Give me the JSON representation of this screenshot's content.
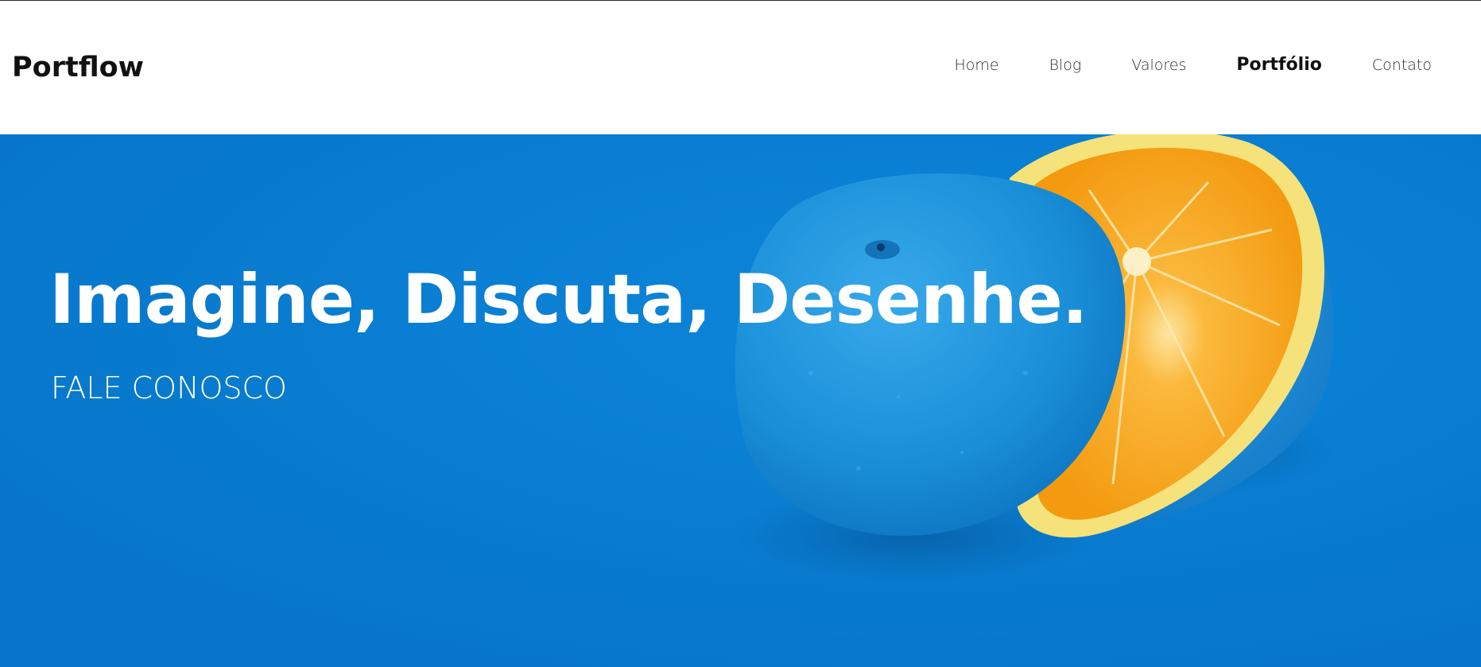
{
  "brand": {
    "name": "Portflow"
  },
  "nav": {
    "items": [
      {
        "label": "Home"
      },
      {
        "label": "Blog"
      },
      {
        "label": "Valores"
      },
      {
        "label": "Portfólio",
        "active": true
      },
      {
        "label": "Contato"
      }
    ]
  },
  "hero": {
    "headline": "Imagine, Discuta, Desenhe.",
    "cta_label": "FALE CONOSCO",
    "image": "halved-blue-painted-orange-photo"
  },
  "colors": {
    "hero_background": "#0a7dd4",
    "orange_skin_blue": "#1a8fd8",
    "orange_flesh": "#f7a51f",
    "orange_rind": "#f6e27a",
    "text_on_hero": "#ffffff",
    "nav_text": "#2e2e2e"
  }
}
